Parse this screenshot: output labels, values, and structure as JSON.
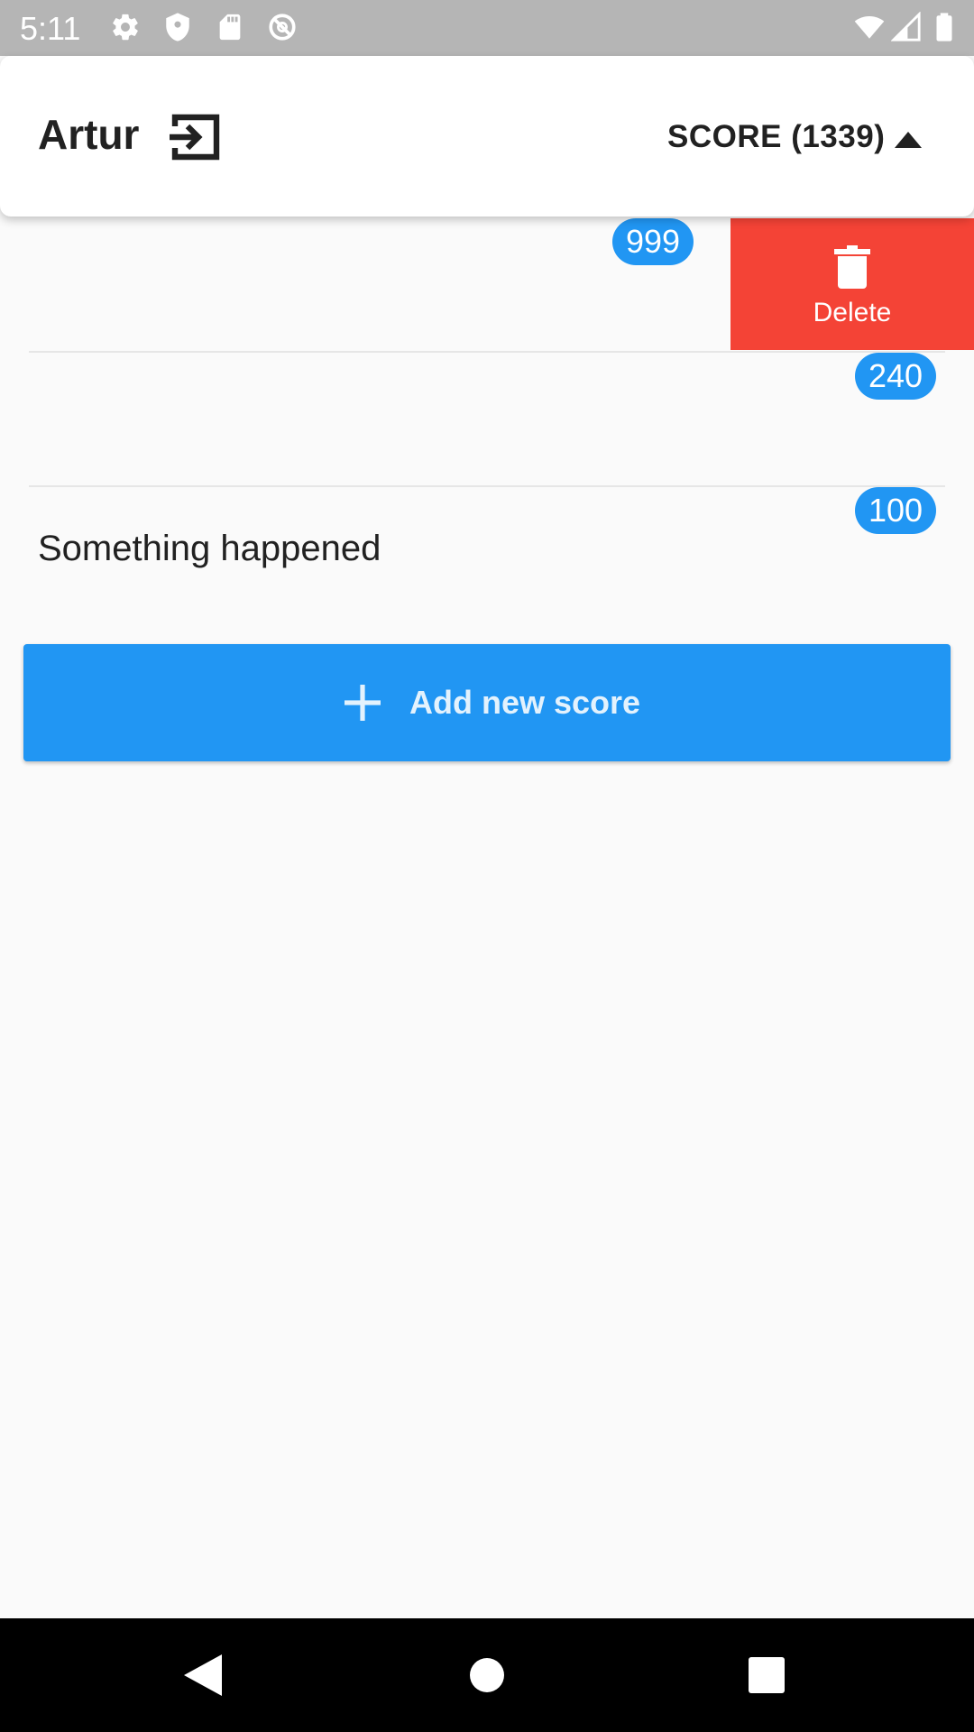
{
  "status_bar": {
    "time": "5:11",
    "left_icons": [
      "gear-icon",
      "shield-icon",
      "sd-card-icon",
      "do-not-disturb-icon"
    ],
    "right_icons": [
      "wifi-icon",
      "cell-signal-icon",
      "battery-icon"
    ]
  },
  "header": {
    "user_name": "Artur",
    "logout_icon": "logout-icon",
    "score_label": "SCORE (1339)",
    "sort_icon": "caret-up-icon"
  },
  "scores": [
    {
      "label": "",
      "points": "999",
      "swiped": true
    },
    {
      "label": "",
      "points": "240",
      "swiped": false
    },
    {
      "label": "Something happened",
      "points": "100",
      "swiped": false
    }
  ],
  "swipe_action": {
    "label": "Delete",
    "icon": "trash-icon",
    "color": "#f44336"
  },
  "add_button": {
    "label": "Add new score",
    "icon": "plus-icon"
  },
  "colors": {
    "primary": "#2196f3",
    "danger": "#f44336",
    "background": "#fafafa"
  },
  "nav_bar": {
    "buttons": [
      "back-icon",
      "home-icon",
      "recents-icon"
    ]
  }
}
